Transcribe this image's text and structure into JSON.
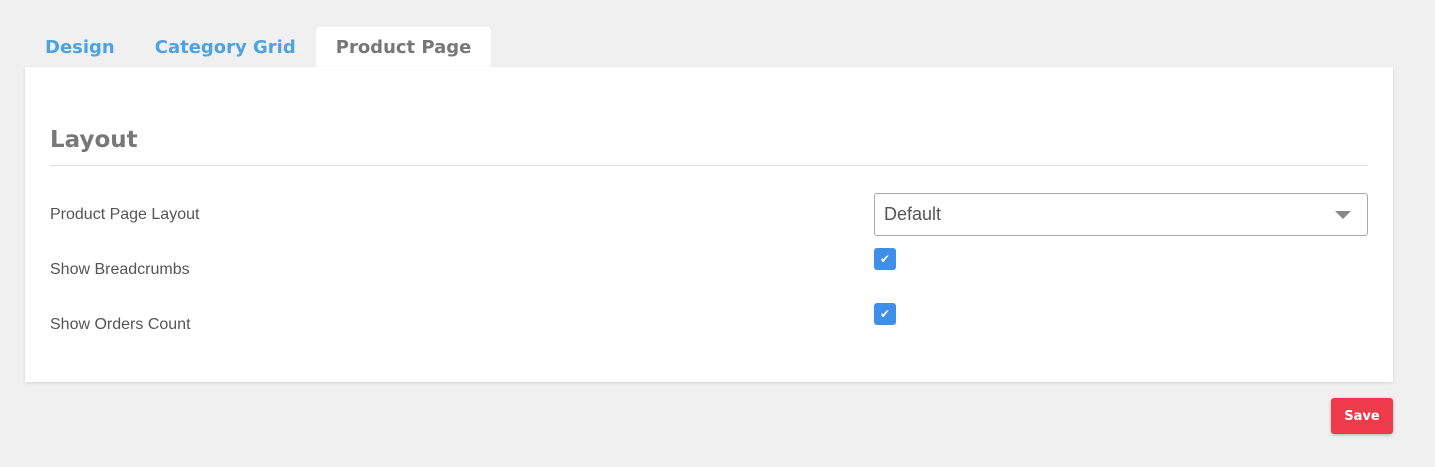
{
  "tabs": [
    {
      "label": "Design",
      "active": false
    },
    {
      "label": "Category Grid",
      "active": false
    },
    {
      "label": "Product Page",
      "active": true
    }
  ],
  "section": {
    "title": "Layout"
  },
  "fields": {
    "layout": {
      "label": "Product Page Layout",
      "value": "Default"
    },
    "breadcrumbs": {
      "label": "Show Breadcrumbs",
      "checked": true,
      "check_glyph": "✔"
    },
    "orders_count": {
      "label": "Show Orders Count",
      "checked": true,
      "check_glyph": "✔"
    }
  },
  "actions": {
    "save_label": "Save"
  },
  "colors": {
    "accent": "#4da3e0",
    "checkbox": "#3d8fe8",
    "save": "#ee3a4a",
    "background": "#f0f0f0"
  }
}
